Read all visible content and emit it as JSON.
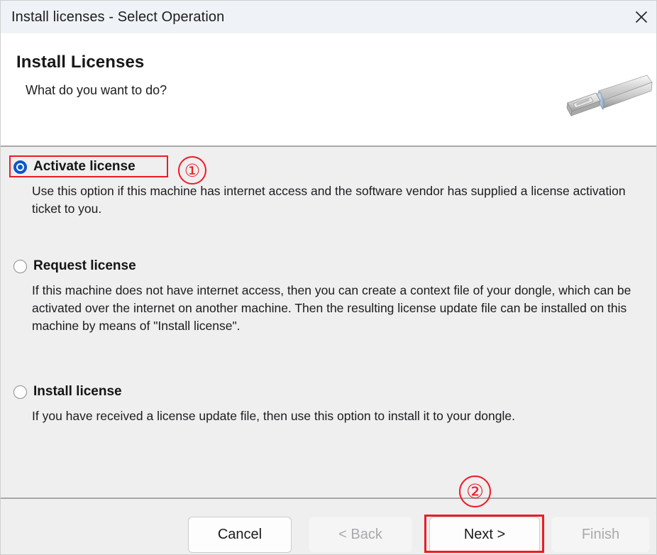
{
  "window": {
    "title": "Install licenses - Select Operation",
    "close_icon": "close-icon"
  },
  "header": {
    "title": "Install Licenses",
    "subtitle": "What do you want to do?",
    "image_icon": "usb-dongle-icon"
  },
  "options": [
    {
      "label": "Activate license",
      "selected": true,
      "description": "Use this option if this machine has internet access and the software vendor has supplied a license activation ticket to you."
    },
    {
      "label": "Request license",
      "selected": false,
      "description": "If this machine does not have internet access, then you can create a context file of your dongle, which can be activated over the internet on another machine. Then the resulting license update file can be installed on this machine by means of \"Install license\"."
    },
    {
      "label": "Install license",
      "selected": false,
      "description": "If you have received a license update file, then use this option to install it to your dongle."
    }
  ],
  "footer": {
    "cancel_label": "Cancel",
    "back_label": "< Back",
    "next_label": "Next >",
    "finish_label": "Finish"
  },
  "annotations": {
    "step1": "①",
    "step2": "②",
    "accent_color": "#ec1c24"
  }
}
